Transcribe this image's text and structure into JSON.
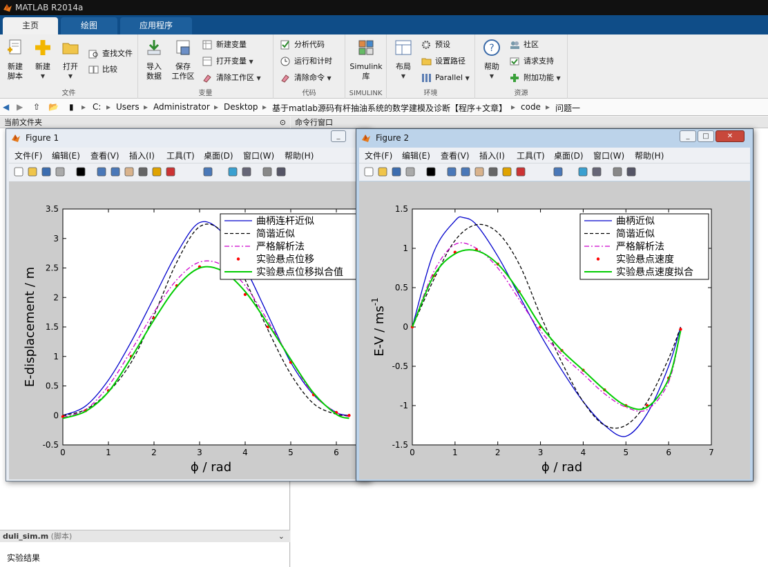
{
  "app": {
    "title": "MATLAB R2014a"
  },
  "tabs": [
    {
      "label": "主页"
    },
    {
      "label": "绘图"
    },
    {
      "label": "应用程序"
    }
  ],
  "ribbon": {
    "file": {
      "group": "文件",
      "new_script": "新建\n脚本",
      "new": "新建",
      "open": "打开",
      "find_files": "查找文件",
      "compare": "比较"
    },
    "variable": {
      "group": "变量",
      "import": "导入\n数据",
      "save_ws": "保存\n工作区",
      "new_var": "新建变量",
      "open_var": "打开变量",
      "clear_ws": "清除工作区"
    },
    "code": {
      "group": "代码",
      "analyze": "分析代码",
      "run_time": "运行和计时",
      "clear_cmd": "清除命令"
    },
    "simulink": {
      "group": "SIMULINK",
      "lib": "Simulink\n库"
    },
    "env": {
      "group": "环境",
      "layout": "布局",
      "prefs": "预设",
      "set_path": "设置路径",
      "parallel": "Parallel"
    },
    "resources": {
      "group": "资源",
      "help": "帮助",
      "community": "社区",
      "support": "请求支持",
      "addons": "附加功能"
    }
  },
  "address": {
    "parts": [
      "C:",
      "Users",
      "Administrator",
      "Desktop",
      "基于matlab源码有杆抽油系统的数学建模及诊断【程序+文章】",
      "code",
      "问题一"
    ]
  },
  "panels": {
    "current_folder": "当前文件夹",
    "command_window": "命令行窗口"
  },
  "editor": {
    "file": "duli_sim.m",
    "kind": "(脚本)",
    "content": "实验结果"
  },
  "menus": [
    "文件(F)",
    "编辑(E)",
    "查看(V)",
    "插入(I)",
    "工具(T)",
    "桌面(D)",
    "窗口(W)",
    "帮助(H)"
  ],
  "figure1": {
    "title": "Figure 1"
  },
  "figure2": {
    "title": "Figure 2"
  },
  "chart_data": [
    {
      "type": "line",
      "xlabel": "ϕ / rad",
      "ylabel": "E-displacement / m",
      "xlim": [
        0,
        6.5
      ],
      "ylim": [
        -0.5,
        3.5
      ],
      "xticks": [
        0,
        1,
        2,
        3,
        4,
        5,
        6
      ],
      "yticks": [
        -0.5,
        0,
        0.5,
        1,
        1.5,
        2,
        2.5,
        3,
        3.5
      ],
      "legend_position": "top-right",
      "series": [
        {
          "name": "曲柄连杆近似",
          "color": "#0000cc",
          "style": "solid",
          "x": [
            0,
            0.5,
            1,
            1.5,
            2,
            2.5,
            3,
            3.5,
            4,
            4.5,
            5,
            5.5,
            6,
            6.28
          ],
          "y": [
            0,
            0.16,
            0.6,
            1.25,
            2.0,
            2.75,
            3.27,
            3.1,
            2.5,
            1.7,
            0.9,
            0.35,
            0.05,
            0
          ]
        },
        {
          "name": "简谐近似",
          "color": "#000000",
          "style": "dashed",
          "x": [
            0,
            0.5,
            1,
            1.5,
            2,
            2.5,
            3,
            3.5,
            4,
            4.5,
            5,
            5.5,
            6,
            6.28
          ],
          "y": [
            0,
            0.1,
            0.4,
            0.9,
            1.7,
            2.6,
            3.2,
            3.1,
            2.3,
            1.45,
            0.7,
            0.2,
            0.02,
            0
          ]
        },
        {
          "name": "严格解析法",
          "color": "#cc00cc",
          "style": "dashdot",
          "x": [
            0,
            0.5,
            1,
            1.5,
            2,
            2.5,
            3,
            3.5,
            4,
            4.5,
            5,
            5.5,
            6,
            6.28
          ],
          "y": [
            -0.03,
            0.1,
            0.5,
            1.1,
            1.75,
            2.3,
            2.6,
            2.55,
            2.2,
            1.6,
            0.95,
            0.35,
            0.05,
            -0.02
          ]
        },
        {
          "name": "实验悬点位移",
          "color": "#ff0000",
          "style": "dots",
          "x": [
            0,
            0.5,
            1,
            1.5,
            2,
            2.5,
            3,
            3.5,
            4,
            4.5,
            5,
            5.5,
            6,
            6.28
          ],
          "y": [
            -0.02,
            0.08,
            0.42,
            1.0,
            1.65,
            2.2,
            2.52,
            2.45,
            2.05,
            1.5,
            0.9,
            0.35,
            0.05,
            0.0
          ]
        },
        {
          "name": "实验悬点位移拟合值",
          "color": "#00cc00",
          "style": "solid",
          "x": [
            0,
            0.5,
            1,
            1.5,
            2,
            2.5,
            3,
            3.5,
            4,
            4.5,
            5,
            5.5,
            6,
            6.28
          ],
          "y": [
            -0.05,
            0.07,
            0.4,
            0.98,
            1.62,
            2.18,
            2.5,
            2.45,
            2.1,
            1.55,
            0.95,
            0.38,
            0.02,
            -0.05
          ]
        }
      ]
    },
    {
      "type": "line",
      "xlabel": "ϕ / rad",
      "ylabel": "E-V / ms",
      "ylabel_sup": "-1",
      "xlim": [
        0,
        7
      ],
      "ylim": [
        -1.5,
        1.5
      ],
      "xticks": [
        0,
        1,
        2,
        3,
        4,
        5,
        6,
        7
      ],
      "yticks": [
        -1.5,
        -1,
        -0.5,
        0,
        0.5,
        1,
        1.5
      ],
      "legend_position": "top-right",
      "series": [
        {
          "name": "曲柄近似",
          "color": "#0000cc",
          "style": "solid",
          "x": [
            0,
            0.5,
            1,
            1.2,
            1.5,
            2,
            2.5,
            3,
            3.5,
            4,
            4.5,
            5,
            5.5,
            6,
            6.28
          ],
          "y": [
            0,
            0.95,
            1.35,
            1.39,
            1.3,
            0.9,
            0.4,
            -0.1,
            -0.55,
            -0.95,
            -1.25,
            -1.39,
            -1.1,
            -0.5,
            0
          ]
        },
        {
          "name": "简谐近似",
          "color": "#000000",
          "style": "dashed",
          "x": [
            0,
            0.5,
            1,
            1.5,
            2,
            2.5,
            3,
            3.5,
            4,
            4.5,
            5,
            5.5,
            6,
            6.28
          ],
          "y": [
            0,
            0.6,
            1.1,
            1.3,
            1.2,
            0.8,
            0.15,
            -0.45,
            -0.95,
            -1.25,
            -1.25,
            -0.95,
            -0.4,
            0
          ]
        },
        {
          "name": "严格解析法",
          "color": "#cc00cc",
          "style": "dashdot",
          "x": [
            0,
            0.5,
            1,
            1.5,
            2,
            2.5,
            3,
            3.5,
            4,
            4.5,
            5,
            5.5,
            6,
            6.28
          ],
          "y": [
            0,
            0.7,
            1.05,
            1.0,
            0.75,
            0.35,
            -0.05,
            -0.35,
            -0.6,
            -0.85,
            -1.02,
            -1.05,
            -0.7,
            -0.05
          ]
        },
        {
          "name": "实验悬点速度",
          "color": "#ff0000",
          "style": "dots",
          "x": [
            0,
            0.5,
            1,
            1.5,
            2,
            2.5,
            3,
            3.5,
            4,
            4.5,
            5,
            5.5,
            6,
            6.28
          ],
          "y": [
            0,
            0.65,
            0.95,
            0.98,
            0.8,
            0.45,
            0.0,
            -0.3,
            -0.55,
            -0.8,
            -1.0,
            -1.0,
            -0.65,
            -0.03
          ]
        },
        {
          "name": "实验悬点速度拟合",
          "color": "#00cc00",
          "style": "solid",
          "x": [
            0,
            0.5,
            1,
            1.5,
            2,
            2.5,
            3,
            3.5,
            4,
            4.5,
            5,
            5.5,
            6,
            6.28
          ],
          "y": [
            0,
            0.65,
            0.93,
            0.97,
            0.8,
            0.45,
            0.02,
            -0.3,
            -0.55,
            -0.8,
            -1.0,
            -1.02,
            -0.66,
            -0.05
          ]
        }
      ]
    }
  ]
}
